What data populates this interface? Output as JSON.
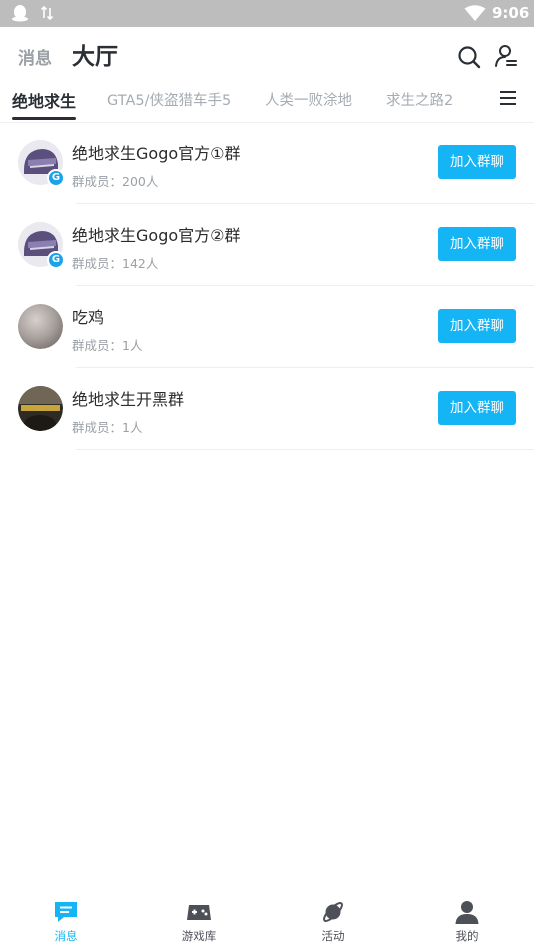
{
  "status_bar": {
    "time": "9:06"
  },
  "header": {
    "tab_messages": "消息",
    "tab_hall": "大厅"
  },
  "game_tabs": [
    {
      "label": "绝地求生",
      "active": true
    },
    {
      "label": "GTA5/侠盗猎车手5",
      "active": false
    },
    {
      "label": "人类一败涂地",
      "active": false
    },
    {
      "label": "求生之路2",
      "active": false
    }
  ],
  "groups": [
    {
      "name": "绝地求生Gogo官方①群",
      "members": "群成员：200人",
      "join_label": "加入群聊",
      "avatar": "helmet-avatar"
    },
    {
      "name": "绝地求生Gogo官方②群",
      "members": "群成员：142人",
      "join_label": "加入群聊",
      "avatar": "helmet-avatar"
    },
    {
      "name": "吃鸡",
      "members": "群成员：1人",
      "join_label": "加入群聊",
      "avatar": "silver-sphere-avatar"
    },
    {
      "name": "绝地求生开黑群",
      "members": "群成员：1人",
      "join_label": "加入群聊",
      "avatar": "battlegrounds-avatar"
    }
  ],
  "bottom_nav": [
    {
      "label": "消息",
      "icon": "message-icon",
      "active": true
    },
    {
      "label": "游戏库",
      "icon": "gamepad-icon",
      "active": false
    },
    {
      "label": "活动",
      "icon": "planet-icon",
      "active": false
    },
    {
      "label": "我的",
      "icon": "profile-icon",
      "active": false
    }
  ],
  "colors": {
    "accent": "#14b4f5",
    "status_bar": "#bdbdbd",
    "title": "#2a2f36"
  }
}
